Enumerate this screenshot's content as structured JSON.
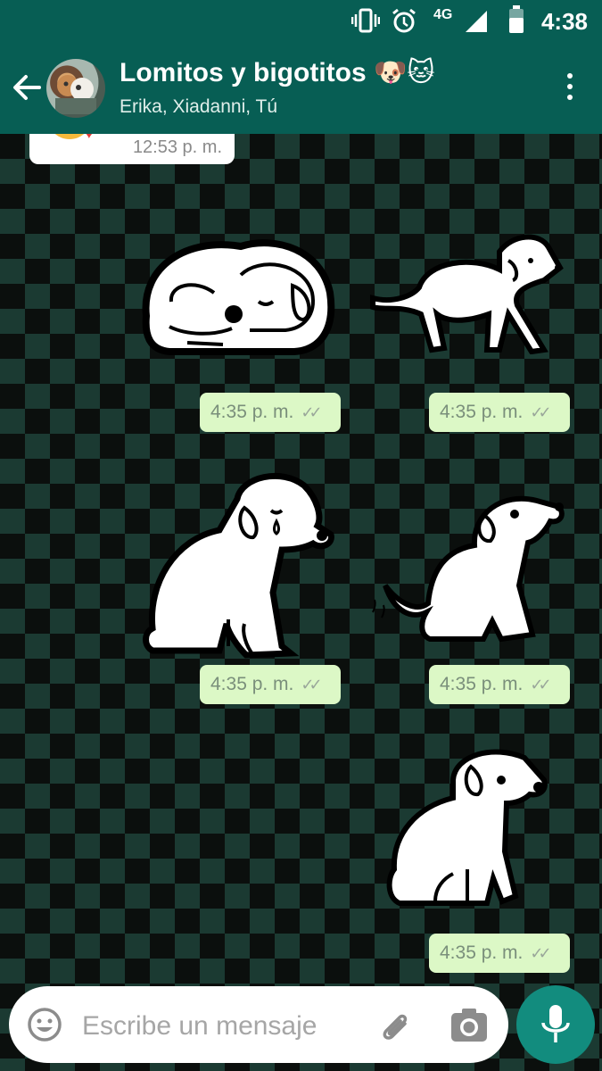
{
  "status_bar": {
    "network": "4G",
    "time": "4:38",
    "icons": [
      "vibrate-icon",
      "alarm-icon",
      "signal-icon",
      "battery-icon"
    ]
  },
  "header": {
    "back_icon": "arrow-left-icon",
    "title": "Lomitos y bigotitos 🐶🐱",
    "subtitle": "Erika, Xiadanni, Tú",
    "menu_icon": "more-vertical-icon"
  },
  "messages": [
    {
      "type": "incoming-emoji",
      "time": "12:53 p. m."
    },
    {
      "type": "sticker",
      "sticker": "sleeping-dog",
      "time": "4:35 p. m.",
      "status": "read"
    },
    {
      "type": "sticker",
      "sticker": "scared-dog",
      "time": "4:35 p. m.",
      "status": "read"
    },
    {
      "type": "sticker",
      "sticker": "crying-dog",
      "time": "4:35 p. m.",
      "status": "read"
    },
    {
      "type": "sticker",
      "sticker": "wagging-dog",
      "time": "4:35 p. m.",
      "status": "read"
    },
    {
      "type": "sticker",
      "sticker": "sitting-dog",
      "time": "4:35 p. m.",
      "status": "read"
    }
  ],
  "composer": {
    "placeholder": "Escribe un mensaje",
    "value": "",
    "icons": [
      "emoji-icon",
      "paperclip-icon",
      "camera-icon",
      "microphone-icon"
    ]
  },
  "colors": {
    "header": "#075e54",
    "bubble_out": "#dcf8c6",
    "mic_button": "#128c7e"
  }
}
